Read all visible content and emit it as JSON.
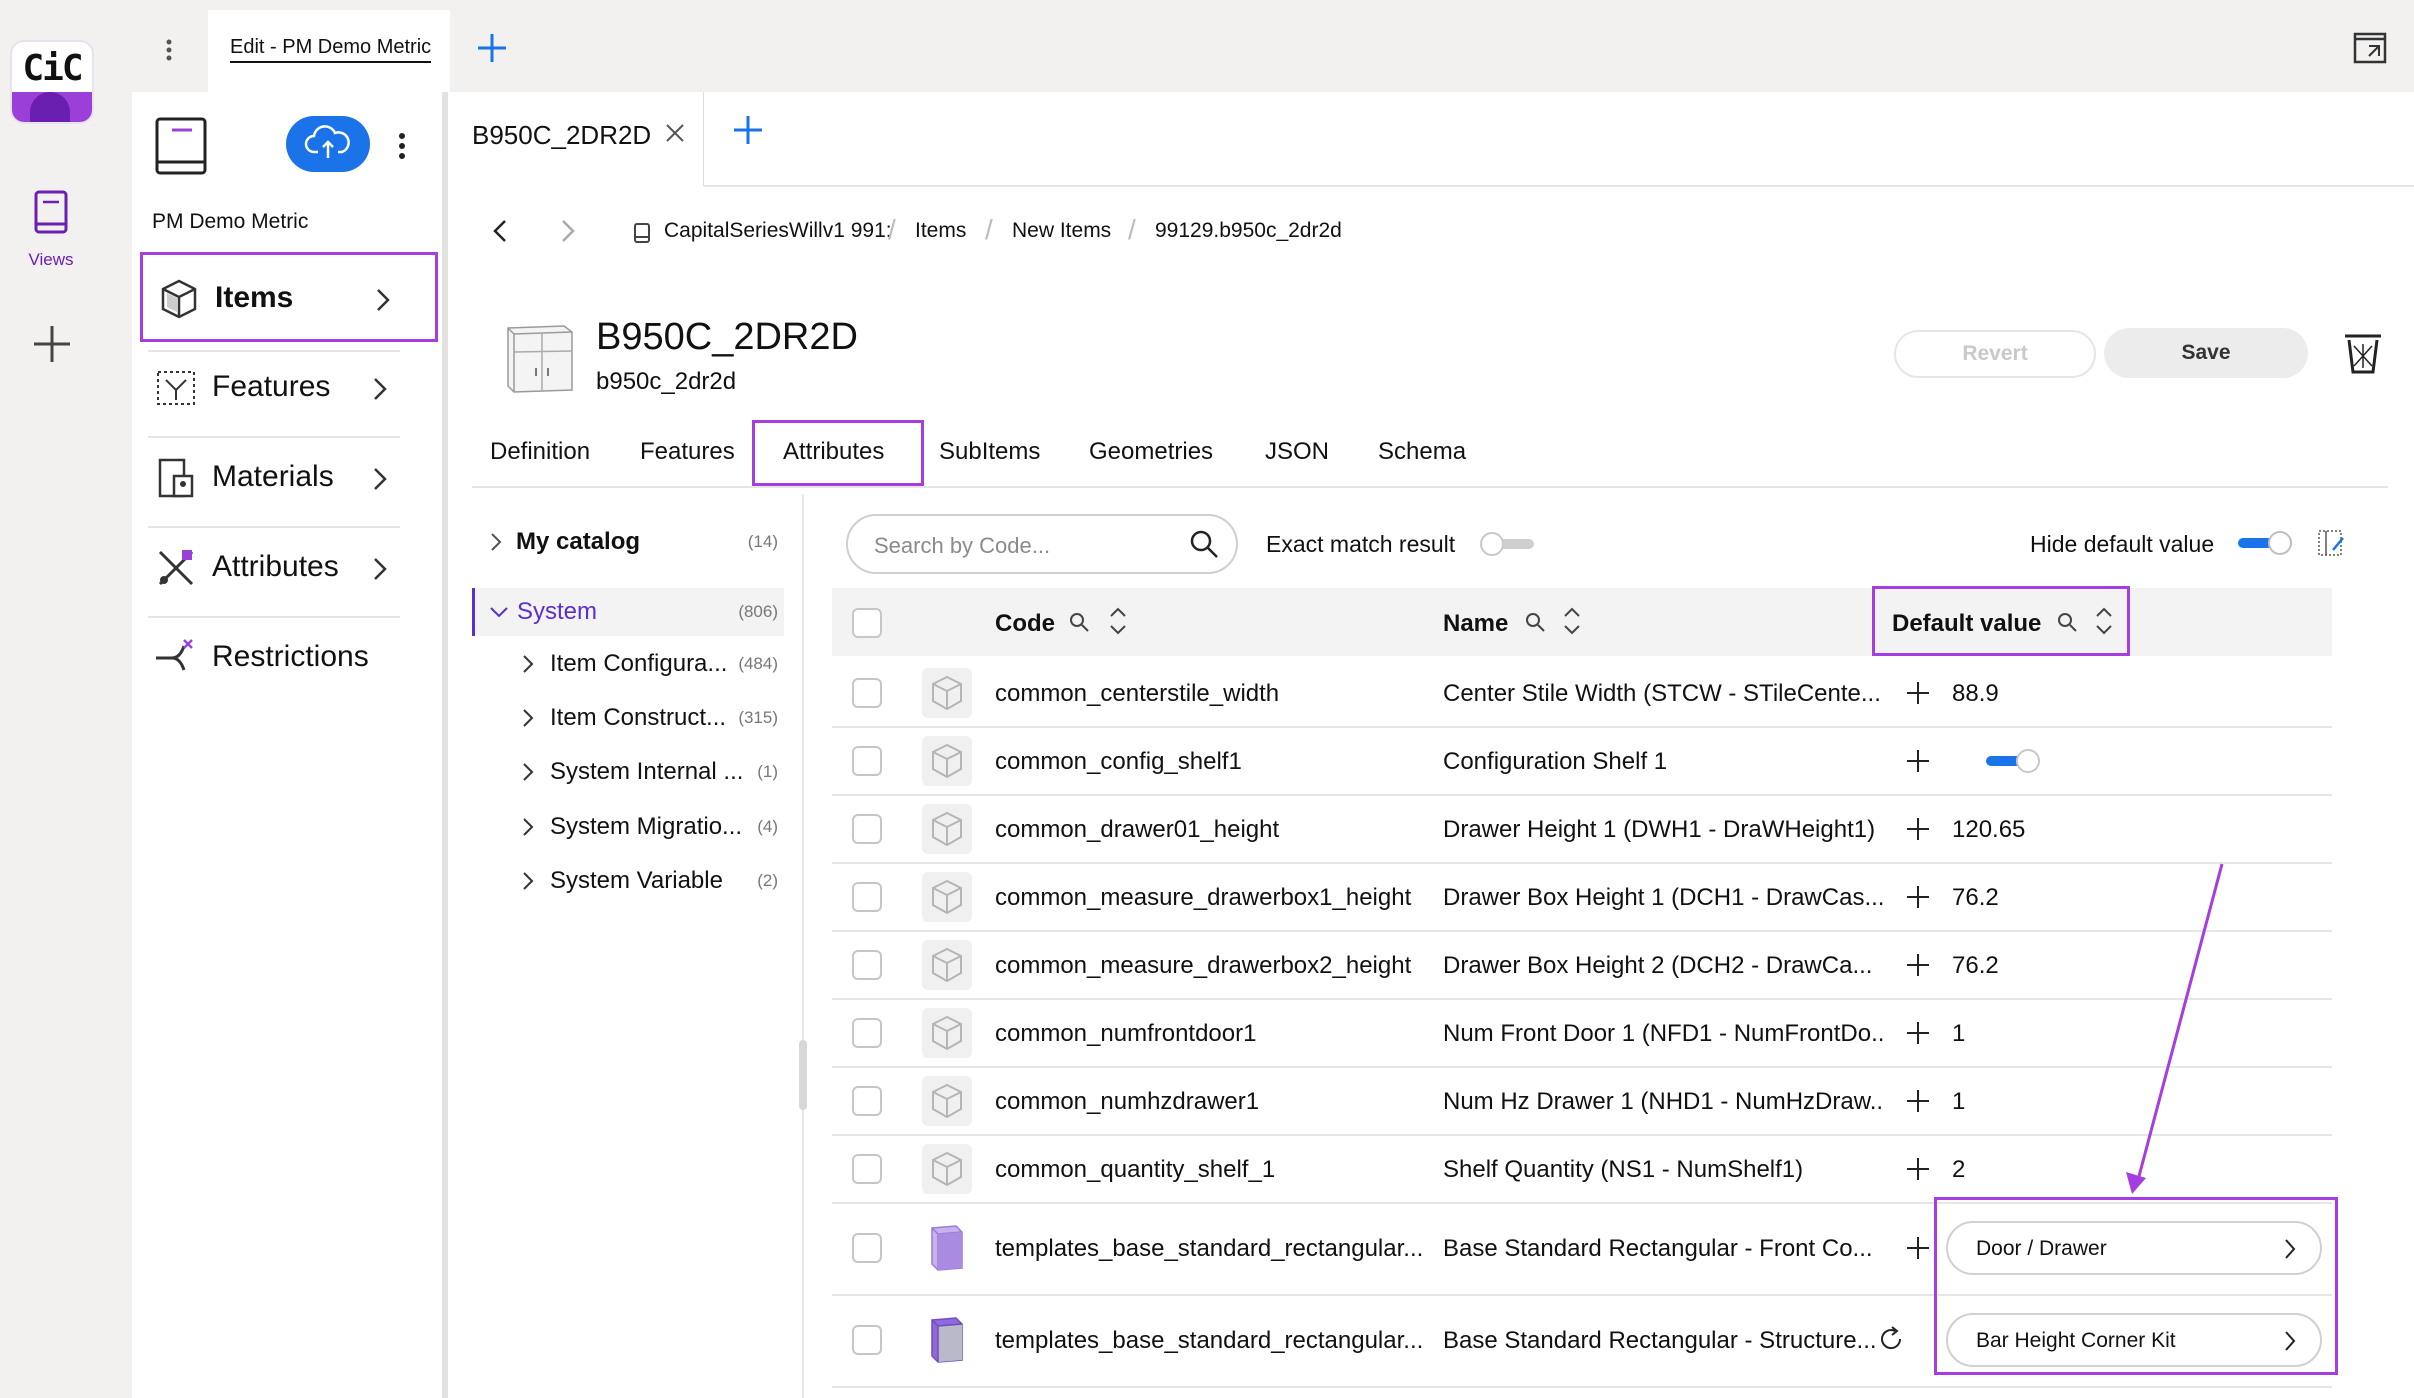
{
  "app": {
    "logo_text": "CiC",
    "brand_color": "#9b3fd9",
    "accent_color": "#1a73e8",
    "highlight_color": "#a63de0"
  },
  "rail": {
    "views_label": "Views"
  },
  "top_tab": {
    "label": "Edit - PM Demo Metric"
  },
  "left_panel": {
    "title": "PM Demo Metric",
    "nav": [
      {
        "label": "Items",
        "icon": "cube-icon"
      },
      {
        "label": "Features",
        "icon": "features-icon"
      },
      {
        "label": "Materials",
        "icon": "materials-icon"
      },
      {
        "label": "Attributes",
        "icon": "attributes-icon"
      },
      {
        "label": "Restrictions",
        "icon": "restrictions-icon"
      }
    ]
  },
  "item_tab": {
    "label": "B950C_2DR2D"
  },
  "breadcrumb": [
    "CapitalSeriesWillv1 991:",
    "Items",
    "New Items",
    "99129.b950c_2dr2d"
  ],
  "item": {
    "title": "B950C_2DR2D",
    "subtitle": "b950c_2dr2d"
  },
  "actions": {
    "revert": "Revert",
    "save": "Save"
  },
  "tabs": [
    "Definition",
    "Features",
    "Attributes",
    "SubItems",
    "Geometries",
    "JSON",
    "Schema"
  ],
  "active_tab": "Attributes",
  "tree": {
    "root": {
      "label": "My catalog",
      "count": "(14)"
    },
    "system": {
      "label": "System",
      "count": "(806)"
    },
    "children": [
      {
        "label": "Item Configura...",
        "count": "(484)"
      },
      {
        "label": "Item Construct...",
        "count": "(315)"
      },
      {
        "label": "System Internal ...",
        "count": "(1)"
      },
      {
        "label": "System Migratio...",
        "count": "(4)"
      },
      {
        "label": "System Variable",
        "count": "(2)"
      }
    ]
  },
  "search": {
    "placeholder": "Search by Code...",
    "value": ""
  },
  "filters": {
    "exact_match_label": "Exact match result",
    "exact_match_on": false,
    "hide_default_label": "Hide default value",
    "hide_default_on": true
  },
  "table": {
    "columns": [
      "Code",
      "Name",
      "Default value"
    ],
    "rows": [
      {
        "code": "common_centerstile_width",
        "name": "Center Stile Width (STCW - STileCente...",
        "value": "88.9"
      },
      {
        "code": "common_config_shelf1",
        "name": "Configuration Shelf 1",
        "value": "",
        "toggle": true
      },
      {
        "code": "common_drawer01_height",
        "name": "Drawer Height 1 (DWH1 - DraWHeight1)",
        "value": "120.65"
      },
      {
        "code": "common_measure_drawerbox1_height",
        "name": "Drawer Box Height 1 (DCH1 - DrawCas...",
        "value": "76.2"
      },
      {
        "code": "common_measure_drawerbox2_height",
        "name": "Drawer Box Height 2 (DCH2 - DrawCa...",
        "value": "76.2"
      },
      {
        "code": "common_numfrontdoor1",
        "name": "Num Front Door 1 (NFD1 - NumFrontDo...",
        "value": "1"
      },
      {
        "code": "common_numhzdrawer1",
        "name": "Num Hz Drawer 1 (NHD1 - NumHzDraw...",
        "value": "1"
      },
      {
        "code": "common_quantity_shelf_1",
        "name": "Shelf Quantity (NS1 - NumShelf1)",
        "value": "2"
      },
      {
        "code": "templates_base_standard_rectangular...",
        "name": "Base Standard Rectangular - Front Co...",
        "pill": "Door / Drawer"
      },
      {
        "code": "templates_base_standard_rectangular...",
        "name": "Base Standard Rectangular - Structure...",
        "pill": "Bar Height Corner Kit"
      }
    ]
  }
}
